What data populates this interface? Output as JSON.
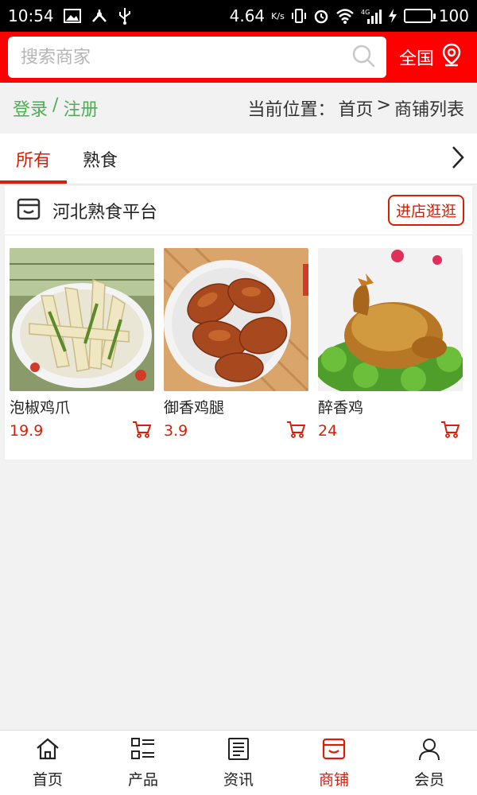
{
  "status_bar": {
    "time": "10:54",
    "speed": "4.64",
    "speed_unit": "K/s",
    "battery": "100",
    "network": "4G"
  },
  "header": {
    "search_placeholder": "搜索商家",
    "region_label": "全国",
    "accent_color": "#ff0000"
  },
  "breadcrumb": {
    "login": "登录",
    "separator": "/",
    "register": "注册",
    "location_label": "当前位置：",
    "home": "首页",
    "arrow": ">",
    "current": "商铺列表"
  },
  "tabs": [
    {
      "label": "所有",
      "active": true
    },
    {
      "label": "熟食",
      "active": false
    }
  ],
  "store": {
    "name": "河北熟食平台",
    "visit_label": "进店逛逛",
    "products": [
      {
        "name": "泡椒鸡爪",
        "price": "19.9"
      },
      {
        "name": "御香鸡腿",
        "price": "3.9"
      },
      {
        "name": "醉香鸡",
        "price": "24"
      }
    ]
  },
  "bottom_nav": [
    {
      "label": "首页",
      "icon": "home-icon",
      "active": false
    },
    {
      "label": "产品",
      "icon": "product-grid-icon",
      "active": false
    },
    {
      "label": "资讯",
      "icon": "news-icon",
      "active": false
    },
    {
      "label": "商铺",
      "icon": "store-icon",
      "active": true
    },
    {
      "label": "会员",
      "icon": "user-icon",
      "active": false
    }
  ],
  "colors": {
    "brand_red": "#d81e06",
    "login_green": "#4caf50"
  }
}
